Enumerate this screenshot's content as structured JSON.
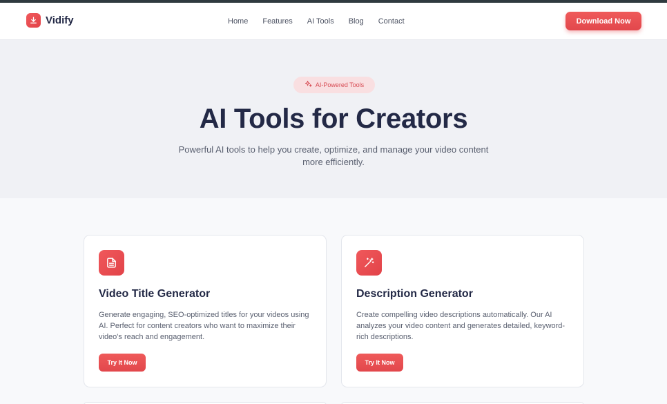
{
  "brand": {
    "name": "Vidify",
    "logo_icon": "download-icon"
  },
  "nav": {
    "items": [
      "Home",
      "Features",
      "AI Tools",
      "Blog",
      "Contact"
    ]
  },
  "header": {
    "download_label": "Download Now"
  },
  "hero": {
    "badge_label": "AI-Powered Tools",
    "badge_icon": "sparkles-icon",
    "title": "AI Tools for Creators",
    "subtitle": "Powerful AI tools to help you create, optimize, and manage your video content more efficiently."
  },
  "cards": [
    {
      "icon": "document-icon",
      "title": "Video Title Generator",
      "description": "Generate engaging, SEO-optimized titles for your videos using AI. Perfect for content creators who want to maximize their video's reach and engagement.",
      "button_label": "Try It Now"
    },
    {
      "icon": "magic-wand-icon",
      "title": "Description Generator",
      "description": "Create compelling video descriptions automatically. Our AI analyzes your video content and generates detailed, keyword-rich descriptions.",
      "button_label": "Try It Now"
    }
  ],
  "colors": {
    "accent": "#e24349",
    "heading": "#232946",
    "badge_bg": "#f9dfe1"
  }
}
